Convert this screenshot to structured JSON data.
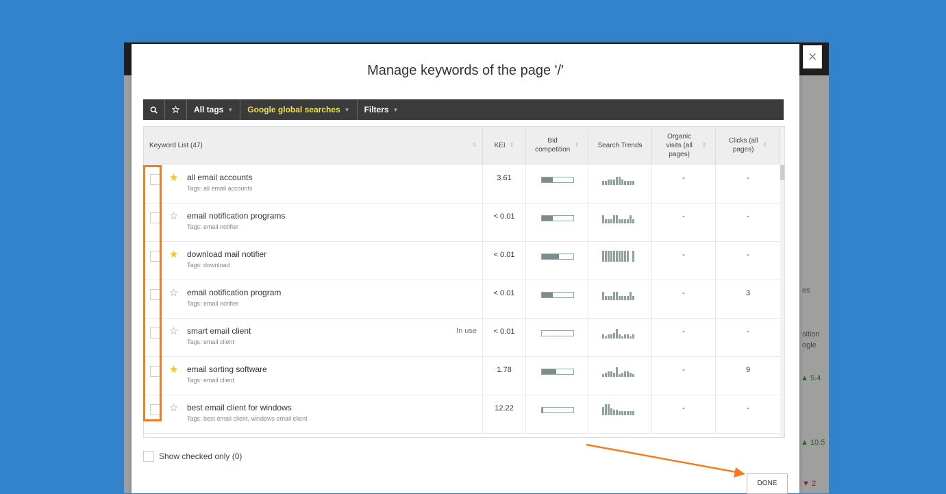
{
  "modal": {
    "title": "Manage keywords of the page '/'",
    "close_label": "×"
  },
  "toolbar": {
    "search_icon": "search-icon",
    "star_icon": "star-icon",
    "all_tags": "All tags",
    "google_global": "Google global searches",
    "filters": "Filters"
  },
  "table": {
    "headers": {
      "keyword_list": "Keyword List (47)",
      "kei": "KEI",
      "bid_competition": "Bid competition",
      "search_trends": "Search Trends",
      "organic_visits": "Organic visits (all pages)",
      "clicks": "Clicks (all pages)"
    },
    "rows": [
      {
        "starred": true,
        "keyword": "all email accounts",
        "tags": "Tags: all email accounts",
        "in_use": "",
        "kei": "3.61",
        "bid": 0.35,
        "trend": [
          6,
          6,
          8,
          8,
          8,
          12,
          12,
          8,
          6,
          6,
          6,
          6
        ],
        "organic": "-",
        "clicks": "-"
      },
      {
        "starred": false,
        "keyword": "email notification programs",
        "tags": "Tags: email notifier",
        "in_use": "",
        "kei": "< 0.01",
        "bid": 0.35,
        "trend": [
          12,
          6,
          6,
          6,
          12,
          12,
          6,
          6,
          6,
          6,
          12,
          6
        ],
        "organic": "-",
        "clicks": "-"
      },
      {
        "starred": true,
        "keyword": "download mail notifier",
        "tags": "Tags: download",
        "in_use": "",
        "kei": "< 0.01",
        "bid": 0.55,
        "trend": [
          16,
          16,
          16,
          16,
          16,
          16,
          16,
          16,
          16,
          16,
          0,
          16
        ],
        "organic": "-",
        "clicks": "-"
      },
      {
        "starred": false,
        "keyword": "email notification program",
        "tags": "Tags: email notifier",
        "in_use": "",
        "kei": "< 0.01",
        "bid": 0.35,
        "trend": [
          12,
          6,
          6,
          6,
          12,
          12,
          6,
          6,
          6,
          6,
          12,
          6
        ],
        "organic": "-",
        "clicks": "3"
      },
      {
        "starred": false,
        "keyword": "smart email client",
        "tags": "Tags: email client",
        "in_use": "In use",
        "kei": "< 0.01",
        "bid": 0.0,
        "trend": [
          6,
          3,
          6,
          6,
          8,
          14,
          6,
          3,
          6,
          6,
          3,
          6
        ],
        "organic": "-",
        "clicks": "-"
      },
      {
        "starred": true,
        "keyword": "email sorting software",
        "tags": "Tags: email client",
        "in_use": "",
        "kei": "1.78",
        "bid": 0.45,
        "trend": [
          4,
          6,
          8,
          8,
          6,
          14,
          4,
          6,
          8,
          8,
          6,
          4
        ],
        "organic": "-",
        "clicks": "9"
      },
      {
        "starred": false,
        "keyword": "best email client for windows",
        "tags": "Tags: best email client, windows email client",
        "in_use": "",
        "kei": "12.22",
        "bid": 0.05,
        "trend": [
          12,
          16,
          16,
          10,
          8,
          8,
          6,
          6,
          6,
          6,
          6,
          6
        ],
        "organic": "-",
        "clicks": "-"
      }
    ]
  },
  "footer": {
    "show_checked": "Show checked only (0)",
    "done": "DONE"
  },
  "background": {
    "es": "es",
    "position": "sition",
    "google": "ogle",
    "val1": "▲ 5.4",
    "val2": "▲ 10.5",
    "val3": "▼ 2"
  },
  "colors": {
    "accent_orange": "#f47b20",
    "star_yellow": "#f5c518",
    "toolbar_yellow": "#f0e05a",
    "background_blue": "#3283cc"
  }
}
